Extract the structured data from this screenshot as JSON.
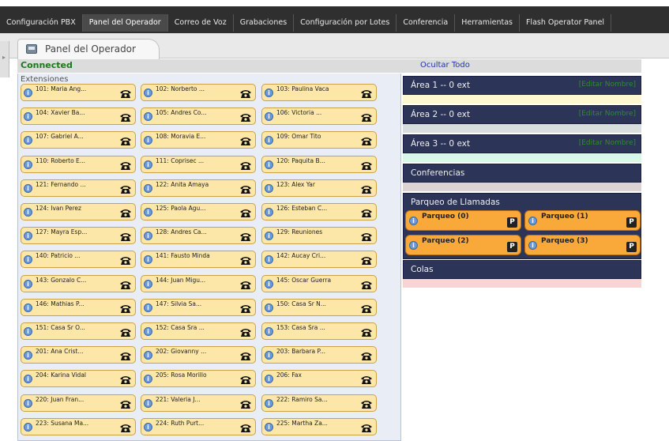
{
  "nav": {
    "items": [
      "Configuración PBX",
      "Panel del Operador",
      "Correo de Voz",
      "Grabaciones",
      "Configuración por Lotes",
      "Conferencia",
      "Herramientas",
      "Flash Operator Panel"
    ],
    "active_index": 1
  },
  "tab": {
    "label": "Panel del Operador"
  },
  "status": {
    "connected": "Connected",
    "hide_all": "Ocultar Todo"
  },
  "extensions": {
    "header": "Extensiones",
    "rows": [
      [
        "101: Maria Ang...",
        "102: Norberto ...",
        "103: Paulina Vaca"
      ],
      [
        "104: Xavier Ba...",
        "105: Andres Co...",
        "106: Victoria ..."
      ],
      [
        "107: Gabriel A...",
        "108: Moravia E...",
        "109: Omar Tito"
      ],
      [
        "110: Roberto E...",
        "111: Coprisec ...",
        "120: Paquita B..."
      ],
      [
        "121: Fernando ...",
        "122: Anita Amaya",
        "123: Alex Yar"
      ],
      [
        "124: Ivan Perez",
        "125: Paola Agu...",
        "126: Esteban C..."
      ],
      [
        "127: Mayra Esp...",
        "128: Andres Ca...",
        "129: Reuniones"
      ],
      [
        "140: Patricio ...",
        "141: Fausto Minda",
        "142: Aucay Cri..."
      ],
      [
        "143: Gonzalo C...",
        "144: Juan Migu...",
        "145: Oscar Guerra"
      ],
      [
        "146: Mathias P...",
        "147: Silvia Sa...",
        "150: Casa Sr N..."
      ],
      [
        "151: Casa Sr O...",
        "152: Casa Sra ...",
        "153: Casa Sra ..."
      ],
      [
        "201: Ana Crist...",
        "202: Giovanny ...",
        "203: Barbara P..."
      ],
      [
        "204: Karina Vidal",
        "205: Rosa Morillo",
        "206: Fax"
      ],
      [
        "220: Juan Fran...",
        "221: Valeria J...",
        "222: Ramiro Sa..."
      ],
      [
        "223: Susana Ma...",
        "224: Ruth Purt...",
        "225: Martha Za..."
      ]
    ]
  },
  "areas": [
    {
      "title": "Área 1 -- 0 ext",
      "edit": "[Editar Nombre]",
      "strip_color": "#fdf7d2"
    },
    {
      "title": "Área 2 -- 0 ext",
      "edit": "[Editar Nombre]",
      "strip_color": "#d8dedd"
    },
    {
      "title": "Área 3 -- 0 ext",
      "edit": "[Editar Nombre]",
      "strip_color": "#d9f7e6"
    }
  ],
  "conferences": {
    "title": "Conferencias",
    "strip_color": "#dcd4d4"
  },
  "parking": {
    "title": "Parqueo de Llamadas",
    "slots": [
      "Parqueo (0)",
      "Parqueo (1)",
      "Parqueo (2)",
      "Parqueo (3)"
    ],
    "badge": "P"
  },
  "queues": {
    "title": "Colas",
    "strip_color": "#f8d4d4"
  },
  "icons": {
    "info": "info-icon",
    "phone": "telephone-icon",
    "park": "parking-icon",
    "tab": "operator-panel-icon",
    "grip": "collapse-arrow-icon"
  },
  "colors": {
    "nav_bg": "#2f2f2f",
    "ext_bg": "#fde7a8",
    "panel_header": "#2c3458",
    "park_bg": "#f9a83a",
    "connected": "#1a7a1a",
    "edit_link": "#2e8b2e"
  }
}
